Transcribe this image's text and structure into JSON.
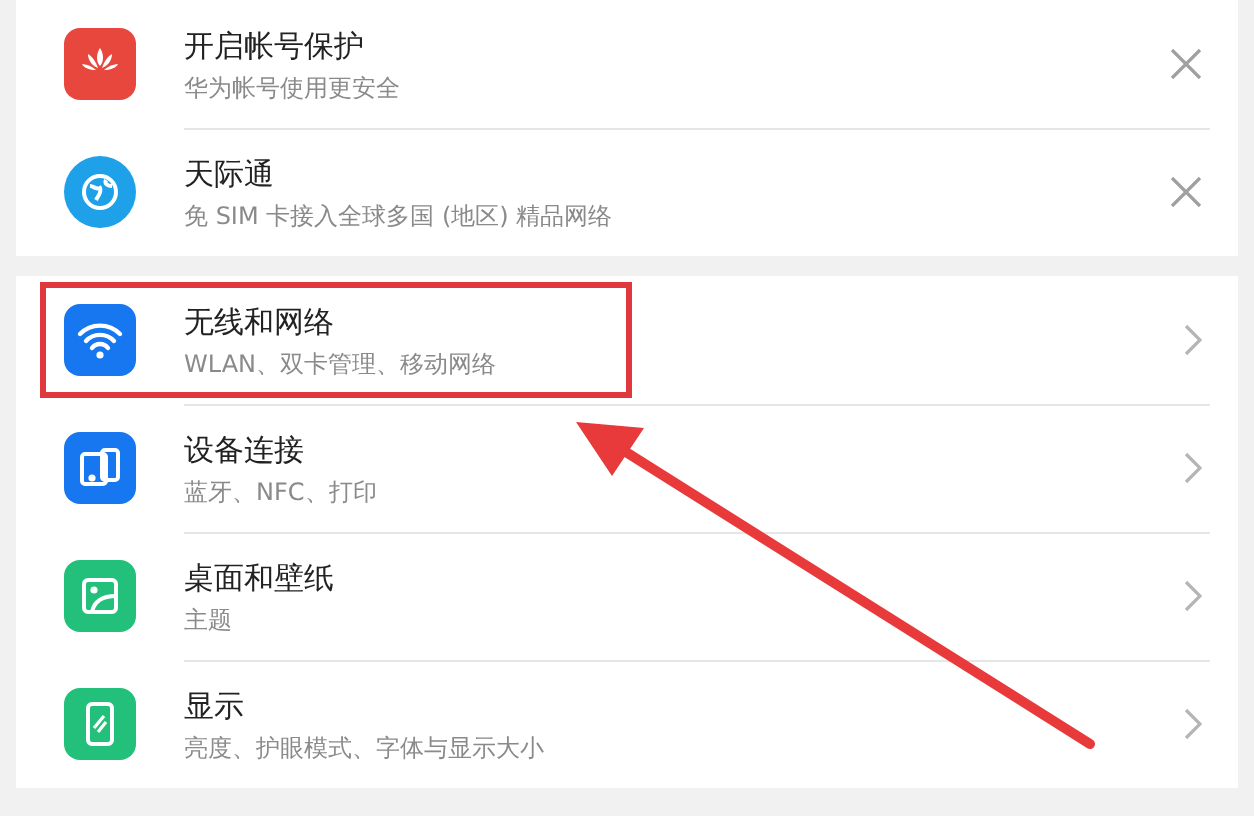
{
  "sections": [
    {
      "items": [
        {
          "kind": "suggestion",
          "color": "#e8473e",
          "title": "开启帐号保护",
          "subtitle": "华为帐号使用更安全",
          "highlighted": false
        },
        {
          "kind": "suggestion",
          "color": "#1ea1e8",
          "title": "天际通",
          "subtitle": "免 SIM 卡接入全球多国 (地区) 精品网络",
          "highlighted": false
        }
      ]
    },
    {
      "items": [
        {
          "kind": "link",
          "color": "#1677f0",
          "title": "无线和网络",
          "subtitle": "WLAN、双卡管理、移动网络",
          "highlighted": true
        },
        {
          "kind": "link",
          "color": "#1677f0",
          "title": "设备连接",
          "subtitle": "蓝牙、NFC、打印",
          "highlighted": false
        },
        {
          "kind": "link",
          "color": "#22c07a",
          "title": "桌面和壁纸",
          "subtitle": "主题",
          "highlighted": false
        },
        {
          "kind": "link",
          "color": "#22c07a",
          "title": "显示",
          "subtitle": "亮度、护眼模式、字体与显示大小",
          "highlighted": false
        }
      ]
    }
  ]
}
